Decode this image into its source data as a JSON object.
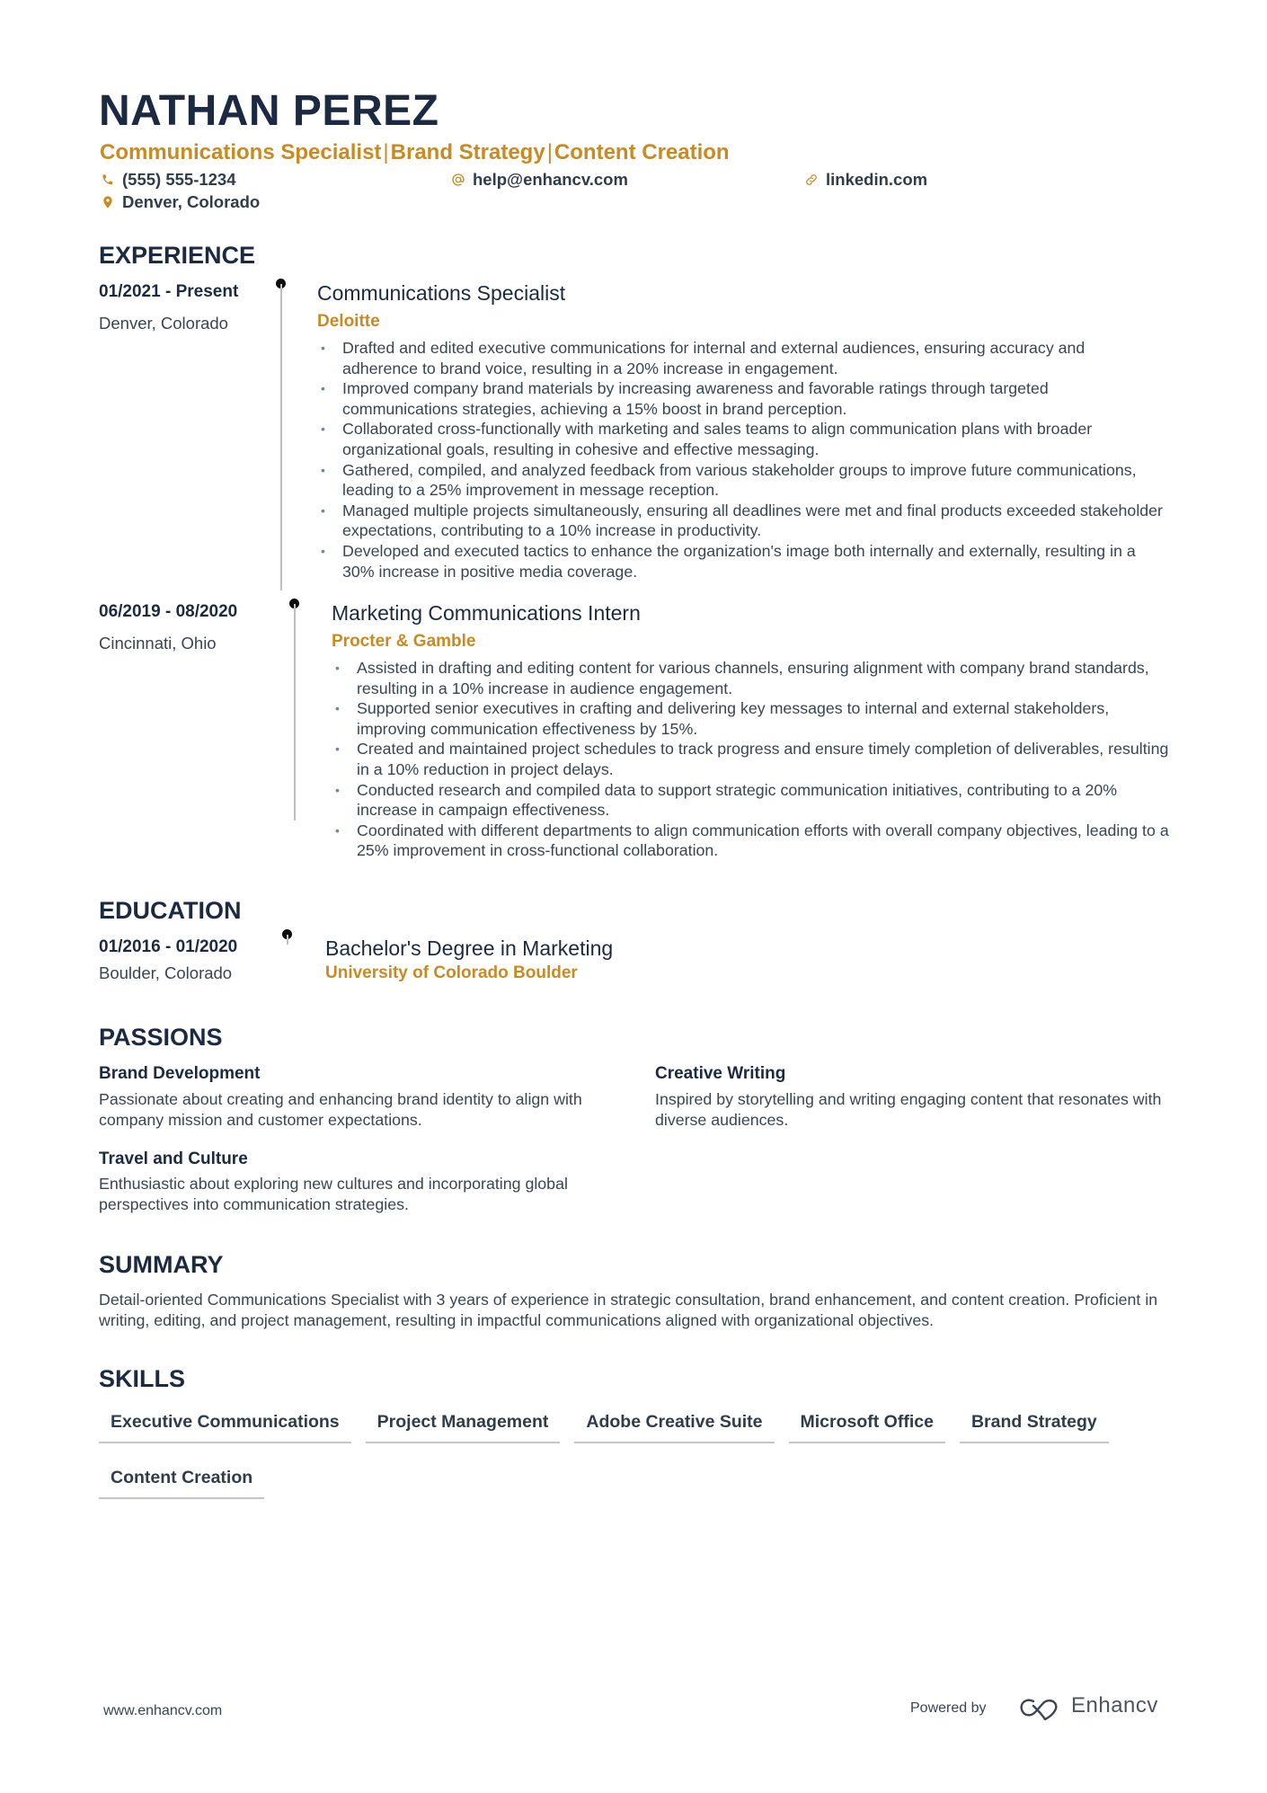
{
  "header": {
    "name": "NATHAN PEREZ",
    "headline": [
      "Communications Specialist",
      "Brand Strategy",
      "Content Creation"
    ],
    "headline_separator": "|",
    "contacts": {
      "phone": {
        "icon": "phone-icon",
        "value": "(555) 555-1234"
      },
      "email": {
        "icon": "at-icon",
        "value": "help@enhancv.com"
      },
      "linkedin": {
        "icon": "link-icon",
        "value": "linkedin.com"
      },
      "location": {
        "icon": "location-pin-icon",
        "value": "Denver, Colorado"
      }
    }
  },
  "colors": {
    "accent": "#c98a22",
    "heading": "#1b2a41",
    "body": "#384652"
  },
  "experience": {
    "title": "EXPERIENCE",
    "items": [
      {
        "dates": "01/2021 - Present",
        "location": "Denver, Colorado",
        "role": "Communications Specialist",
        "company": "Deloitte",
        "bullets": [
          "Drafted and edited executive communications for internal and external audiences, ensuring accuracy and adherence to brand voice, resulting in a 20% increase in engagement.",
          "Improved company brand materials by increasing awareness and favorable ratings through targeted communications strategies, achieving a 15% boost in brand perception.",
          "Collaborated cross-functionally with marketing and sales teams to align communication plans with broader organizational goals, resulting in cohesive and effective messaging.",
          "Gathered, compiled, and analyzed feedback from various stakeholder groups to improve future communications, leading to a 25% improvement in message reception.",
          "Managed multiple projects simultaneously, ensuring all deadlines were met and final products exceeded stakeholder expectations, contributing to a 10% increase in productivity.",
          "Developed and executed tactics to enhance the organization's image both internally and externally, resulting in a 30% increase in positive media coverage."
        ]
      },
      {
        "dates": "06/2019 - 08/2020",
        "location": "Cincinnati, Ohio",
        "role": "Marketing Communications Intern",
        "company": "Procter & Gamble",
        "bullets": [
          "Assisted in drafting and editing content for various channels, ensuring alignment with company brand standards, resulting in a 10% increase in audience engagement.",
          "Supported senior executives in crafting and delivering key messages to internal and external stakeholders, improving communication effectiveness by 15%.",
          "Created and maintained project schedules to track progress and ensure timely completion of deliverables, resulting in a 10% reduction in project delays.",
          "Conducted research and compiled data to support strategic communication initiatives, contributing to a 20% increase in campaign effectiveness.",
          "Coordinated with different departments to align communication efforts with overall company objectives, leading to a 25% improvement in cross-functional collaboration."
        ]
      }
    ]
  },
  "education": {
    "title": "EDUCATION",
    "items": [
      {
        "dates": "01/2016 - 01/2020",
        "location": "Boulder, Colorado",
        "degree": "Bachelor's Degree in Marketing",
        "school": "University of Colorado Boulder"
      }
    ]
  },
  "passions": {
    "title": "PASSIONS",
    "items": [
      {
        "title": "Brand Development",
        "description": "Passionate about creating and enhancing brand identity to align with company mission and customer expectations."
      },
      {
        "title": "Creative Writing",
        "description": "Inspired by storytelling and writing engaging content that resonates with diverse audiences."
      },
      {
        "title": "Travel and Culture",
        "description": "Enthusiastic about exploring new cultures and incorporating global perspectives into communication strategies."
      }
    ]
  },
  "summary": {
    "title": "SUMMARY",
    "text": "Detail-oriented Communications Specialist with 3 years of experience in strategic consultation, brand enhancement, and content creation. Proficient in writing, editing, and project management, resulting in impactful communications aligned with organizational objectives."
  },
  "skills": {
    "title": "SKILLS",
    "items": [
      "Executive Communications",
      "Project Management",
      "Adobe Creative Suite",
      "Microsoft Office",
      "Brand Strategy",
      "Content Creation"
    ]
  },
  "footer": {
    "url": "www.enhancv.com",
    "powered_by": "Powered by",
    "brand": "Enhancv",
    "brand_icon": "enhancv-logo-icon"
  }
}
